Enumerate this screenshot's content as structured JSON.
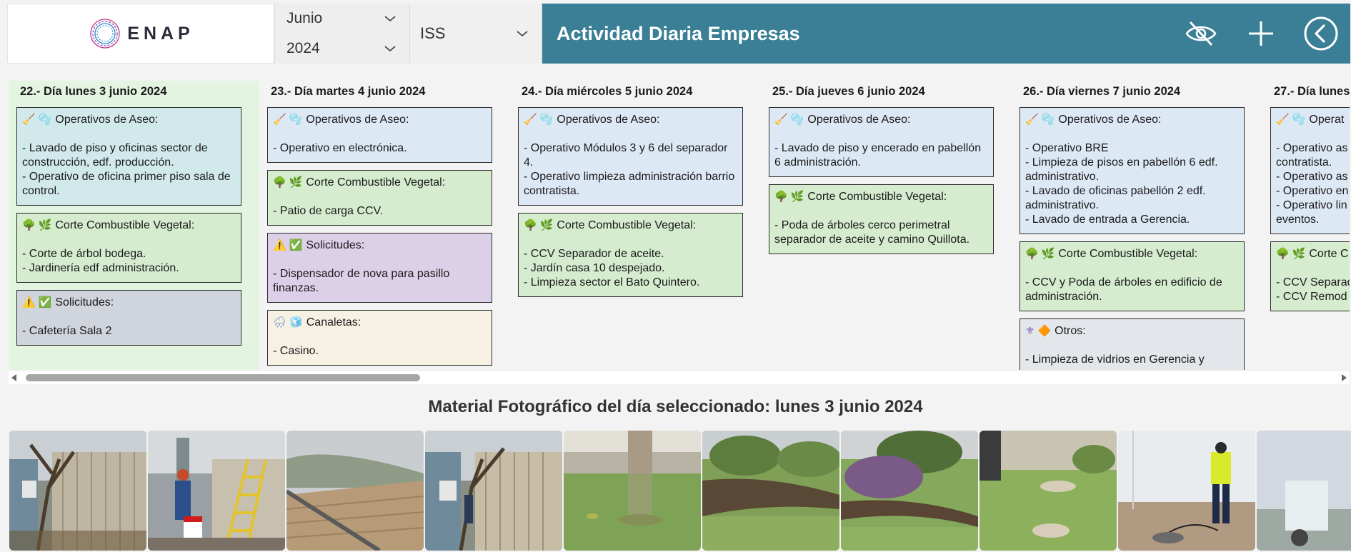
{
  "header": {
    "logo_text": "ENAP",
    "month_value": "Junio",
    "year_value": "2024",
    "company_value": "ISS",
    "title": "Actividad Diaria Empresas",
    "icons": [
      "eye-off-icon",
      "plus-icon",
      "back-circle-icon"
    ],
    "accent_color": "#3a7f96"
  },
  "days": [
    {
      "heading": "22.- Día lunes 3 junio 2024",
      "cards": [
        {
          "kind": "aseo",
          "title": "Operativos de Aseo:",
          "lines": [
            "- Lavado de piso y oficinas sector de construcción, edf. producción.",
            "- Operativo de oficina primer piso sala de control."
          ]
        },
        {
          "kind": "corte",
          "title": "Corte Combustible Vegetal:",
          "lines": [
            "- Corte de árbol bodega.",
            "- Jardinería edf administración."
          ]
        },
        {
          "kind": "soli",
          "title": "Solicitudes:",
          "lines": [
            "- Cafetería Sala 2"
          ]
        }
      ]
    },
    {
      "heading": "23.- Día martes 4 junio 2024",
      "cards": [
        {
          "kind": "aseo",
          "title": "Operativos de Aseo:",
          "lines": [
            "- Operativo en electrónica."
          ]
        },
        {
          "kind": "corte",
          "title": "Corte Combustible Vegetal:",
          "lines": [
            "- Patio de carga CCV."
          ]
        },
        {
          "kind": "soli",
          "title": "Solicitudes:",
          "lines": [
            "- Dispensador de nova para pasillo finanzas."
          ]
        },
        {
          "kind": "cana",
          "title": "Canaletas:",
          "lines": [
            "- Casino."
          ]
        }
      ]
    },
    {
      "heading": "24.- Día miércoles 5 junio 2024",
      "cards": [
        {
          "kind": "aseo",
          "title": "Operativos de Aseo:",
          "lines": [
            "- Operativo Módulos 3 y 6 del separador 4.",
            "- Operativo limpieza administración barrio contratista."
          ]
        },
        {
          "kind": "corte",
          "title": "Corte Combustible Vegetal:",
          "lines": [
            "- CCV Separador de aceite.",
            "- Jardín casa 10 despejado.",
            "- Limpieza sector el Bato Quintero."
          ]
        }
      ]
    },
    {
      "heading": "25.- Día jueves 6 junio 2024",
      "cards": [
        {
          "kind": "aseo",
          "title": "Operativos de Aseo:",
          "lines": [
            "- Lavado de piso y encerado en pabellón 6 administración."
          ]
        },
        {
          "kind": "corte",
          "title": "Corte Combustible Vegetal:",
          "lines": [
            "- Poda de árboles cerco perimetral separador de aceite y camino Quillota."
          ]
        }
      ]
    },
    {
      "heading": "26.- Día viernes 7 junio 2024",
      "cards": [
        {
          "kind": "aseo",
          "title": "Operativos de Aseo:",
          "lines": [
            "- Operativo BRE",
            "- Limpieza de pisos en pabellón 6 edf. administrativo.",
            "- Lavado de oficinas pabellón 2 edf. administrativo.",
            "- Lavado de entrada a Gerencia."
          ]
        },
        {
          "kind": "corte",
          "title": "Corte Combustible Vegetal:",
          "lines": [
            "- CCV y Poda de árboles en edificio de administración."
          ]
        },
        {
          "kind": "otros",
          "title": "Otros:",
          "lines": [
            "- Limpieza de vidrios en Gerencia y"
          ]
        }
      ]
    },
    {
      "heading": "27.- Día lunes",
      "cards": [
        {
          "kind": "aseo",
          "title": "Operat",
          "lines": [
            "- Operativo as",
            "contratista.",
            "- Operativo as",
            "- Operativo en",
            "- Operativo lin",
            "eventos."
          ]
        },
        {
          "kind": "corte",
          "title": "Corte C",
          "lines": [
            "- CCV Separad",
            "- CCV Remod"
          ]
        }
      ]
    }
  ],
  "photos": {
    "title": "Material Fotográfico del día seleccionado: lunes 3 junio 2024"
  }
}
